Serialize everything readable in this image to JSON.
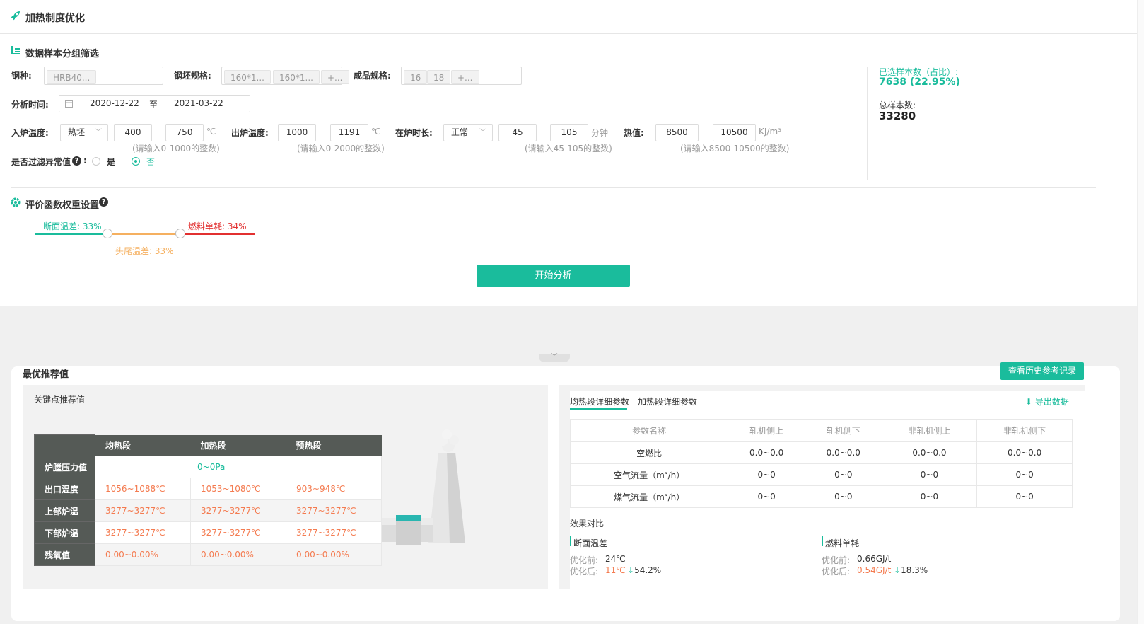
{
  "header": {
    "title": "加热制度优化"
  },
  "filter": {
    "section_title": "数据样本分组筛选",
    "steel_label": "钢种:",
    "steel_tags": [
      "HRB40..."
    ],
    "billet_label": "钢坯规格:",
    "billet_tags": [
      "160*1...",
      "160*1...",
      "+..."
    ],
    "product_label": "成品规格:",
    "product_tags": [
      "16",
      "18",
      "+..."
    ],
    "time_label": "分析时间:",
    "date_start": "2020-12-22",
    "date_sep": "至",
    "date_end": "2021-03-22",
    "in_temp_label": "入炉温度:",
    "in_temp_mode": "热坯",
    "in_temp_min": "400",
    "in_temp_max": "750",
    "in_temp_unit": "℃",
    "in_temp_hint": "(请输入0-1000的整数)",
    "out_temp_label": "出炉温度:",
    "out_temp_min": "1000",
    "out_temp_max": "1191",
    "out_temp_unit": "℃",
    "out_temp_hint": "(请输入0-2000的整数)",
    "duration_label": "在炉时长:",
    "duration_mode": "正常",
    "duration_min": "45",
    "duration_max": "105",
    "duration_unit": "分钟",
    "duration_hint": "(请输入45-105的整数)",
    "heat_label": "热值:",
    "heat_min": "8500",
    "heat_max": "10500",
    "heat_unit": "KJ/m³",
    "heat_hint": "(请输入8500-10500的整数)",
    "dash": "—",
    "filter_outlier_label": "是否过滤异常值",
    "colon": ":",
    "yes": "是",
    "no": "否",
    "selected_label": "已选样本数（占比）:",
    "selected_value": "7638 (22.95%)",
    "total_label": "总样本数:",
    "total_value": "33280"
  },
  "weights": {
    "section_title": "评价函数权重设置",
    "w1_label": "断面温差: 33%",
    "w1": 33,
    "w2_label": "头尾温差: 33%",
    "w2": 33,
    "w3_label": "燃料单耗: 34%",
    "w3": 34,
    "start_button": "开始分析"
  },
  "result": {
    "title": "最优推荐值",
    "history_button": "查看历史参考记录",
    "key_title": "关键点推荐值",
    "key_columns": [
      "均热段",
      "加热段",
      "预热段"
    ],
    "key_rows": [
      {
        "name": "炉膛压力值",
        "merged": "0~0Pa"
      },
      {
        "name": "出口温度",
        "values": [
          "1056~1088℃",
          "1053~1080℃",
          "903~948℃"
        ]
      },
      {
        "name": "上部炉温",
        "values": [
          "3277~3277℃",
          "3277~3277℃",
          "3277~3277℃"
        ]
      },
      {
        "name": "下部炉温",
        "values": [
          "3277~3277℃",
          "3277~3277℃",
          "3277~3277℃"
        ]
      },
      {
        "name": "残氧值",
        "values": [
          "0.00~0.00%",
          "0.00~0.00%",
          "0.00~0.00%"
        ]
      }
    ],
    "tabs": [
      "均热段详细参数",
      "加热段详细参数"
    ],
    "export": "导出数据",
    "detail_columns": [
      "参数名称",
      "轧机侧上",
      "轧机侧下",
      "非轧机侧上",
      "非轧机侧下"
    ],
    "detail_rows": [
      {
        "name": "空燃比",
        "values": [
          "0.0~0.0",
          "0.0~0.0",
          "0.0~0.0",
          "0.0~0.0"
        ]
      },
      {
        "name": "空气流量（m³/h）",
        "values": [
          "0~0",
          "0~0",
          "0~0",
          "0~0"
        ]
      },
      {
        "name": "煤气流量（m³/h）",
        "values": [
          "0~0",
          "0~0",
          "0~0",
          "0~0"
        ]
      }
    ],
    "effect_title": "效果对比",
    "effects": [
      {
        "title": "断面温差",
        "before_label": "优化前:",
        "before": "24℃",
        "after_label": "优化后:",
        "after": "11℃",
        "delta": "54.2%"
      },
      {
        "title": "燃料单耗",
        "before_label": "优化前:",
        "before": "0.66GJ/t",
        "after_label": "优化后:",
        "after": "0.54GJ/t",
        "delta": "18.3%"
      }
    ]
  },
  "colors": {
    "accent": "#1abc9c",
    "orange": "#f47b50",
    "weight_green": "#1abc9c",
    "weight_orange": "#f5b060",
    "weight_red": "#e23030"
  }
}
